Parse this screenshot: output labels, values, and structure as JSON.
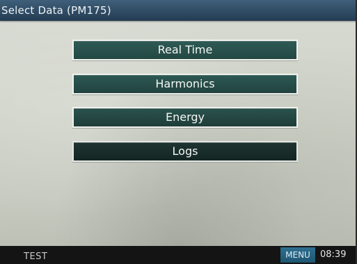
{
  "window": {
    "title": "Select Data (PM175)"
  },
  "menu": {
    "items": [
      {
        "label": "Real Time"
      },
      {
        "label": "Harmonics"
      },
      {
        "label": "Energy"
      },
      {
        "label": "Logs"
      }
    ]
  },
  "statusbar": {
    "left_text": "TEST",
    "menu_label": "MENU",
    "time": "08:39"
  },
  "colors": {
    "titlebar": "#2e4a62",
    "button_fill": "#234843",
    "button_border": "#f2f2ee",
    "menu_key": "#1f5672",
    "statusbar": "#141414"
  }
}
